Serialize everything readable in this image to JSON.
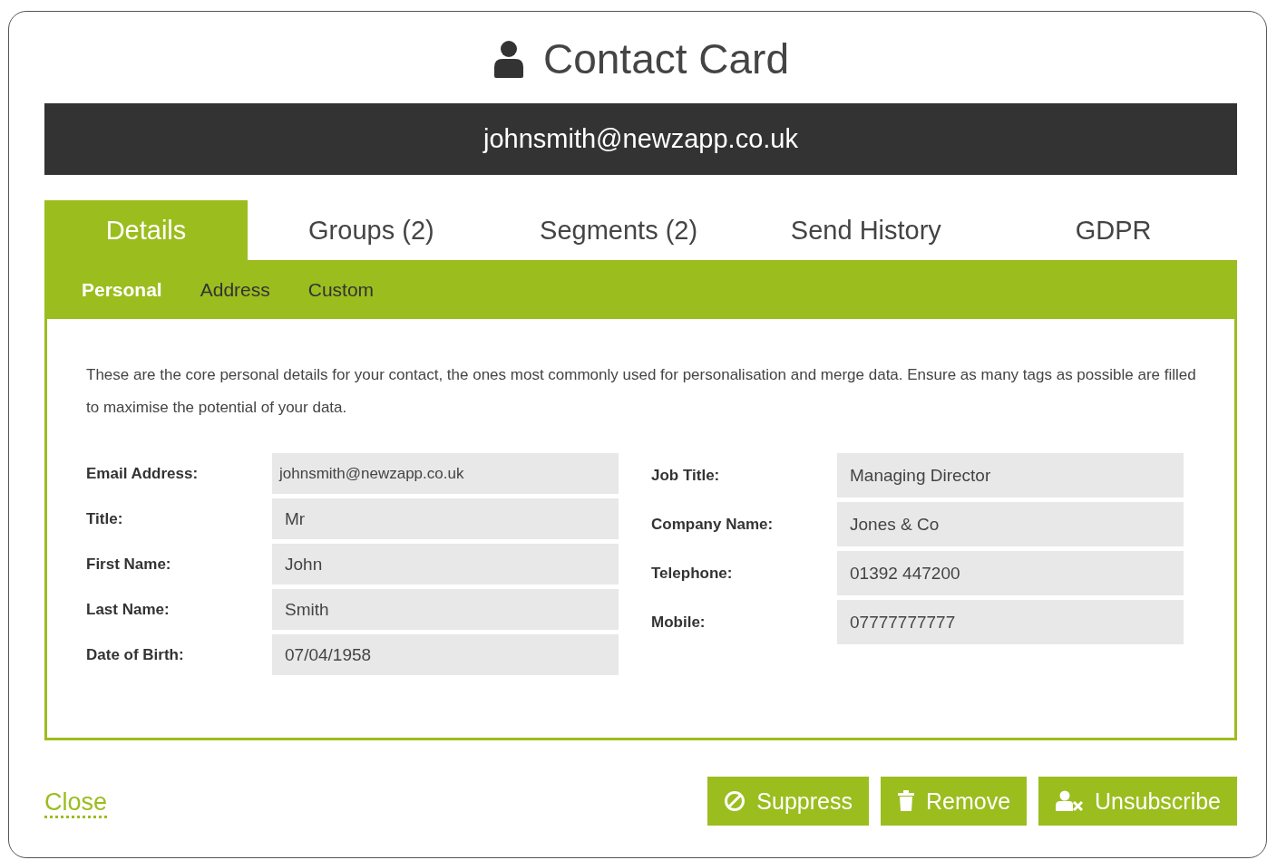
{
  "title": "Contact Card",
  "email_banner": "johnsmith@newzapp.co.uk",
  "tabs": [
    {
      "label": "Details",
      "selected": true
    },
    {
      "label": "Groups (2)",
      "selected": false
    },
    {
      "label": "Segments (2)",
      "selected": false
    },
    {
      "label": "Send History",
      "selected": false
    },
    {
      "label": "GDPR",
      "selected": false
    }
  ],
  "subtabs": [
    {
      "label": "Personal",
      "selected": true
    },
    {
      "label": "Address",
      "selected": false
    },
    {
      "label": "Custom",
      "selected": false
    }
  ],
  "description": "These are the core personal details for your contact, the ones most commonly used for personalisation and merge data. Ensure as many tags as possible are filled to maximise the potential of your data.",
  "left_fields": [
    {
      "label": "Email Address:",
      "value": "johnsmith@newzapp.co.uk"
    },
    {
      "label": "Title:",
      "value": "Mr"
    },
    {
      "label": "First Name:",
      "value": "John"
    },
    {
      "label": "Last Name:",
      "value": "Smith"
    },
    {
      "label": "Date of Birth:",
      "value": "07/04/1958"
    }
  ],
  "right_fields": [
    {
      "label": "Job Title:",
      "value": "Managing Director"
    },
    {
      "label": "Company Name:",
      "value": "Jones & Co"
    },
    {
      "label": "Telephone:",
      "value": "01392 447200"
    },
    {
      "label": "Mobile:",
      "value": "07777777777"
    }
  ],
  "close_link": "Close",
  "buttons": [
    {
      "kind": "suppress",
      "label": "Suppress"
    },
    {
      "kind": "remove",
      "label": "Remove"
    },
    {
      "kind": "unsubscribe",
      "label": "Unsubscribe"
    }
  ]
}
